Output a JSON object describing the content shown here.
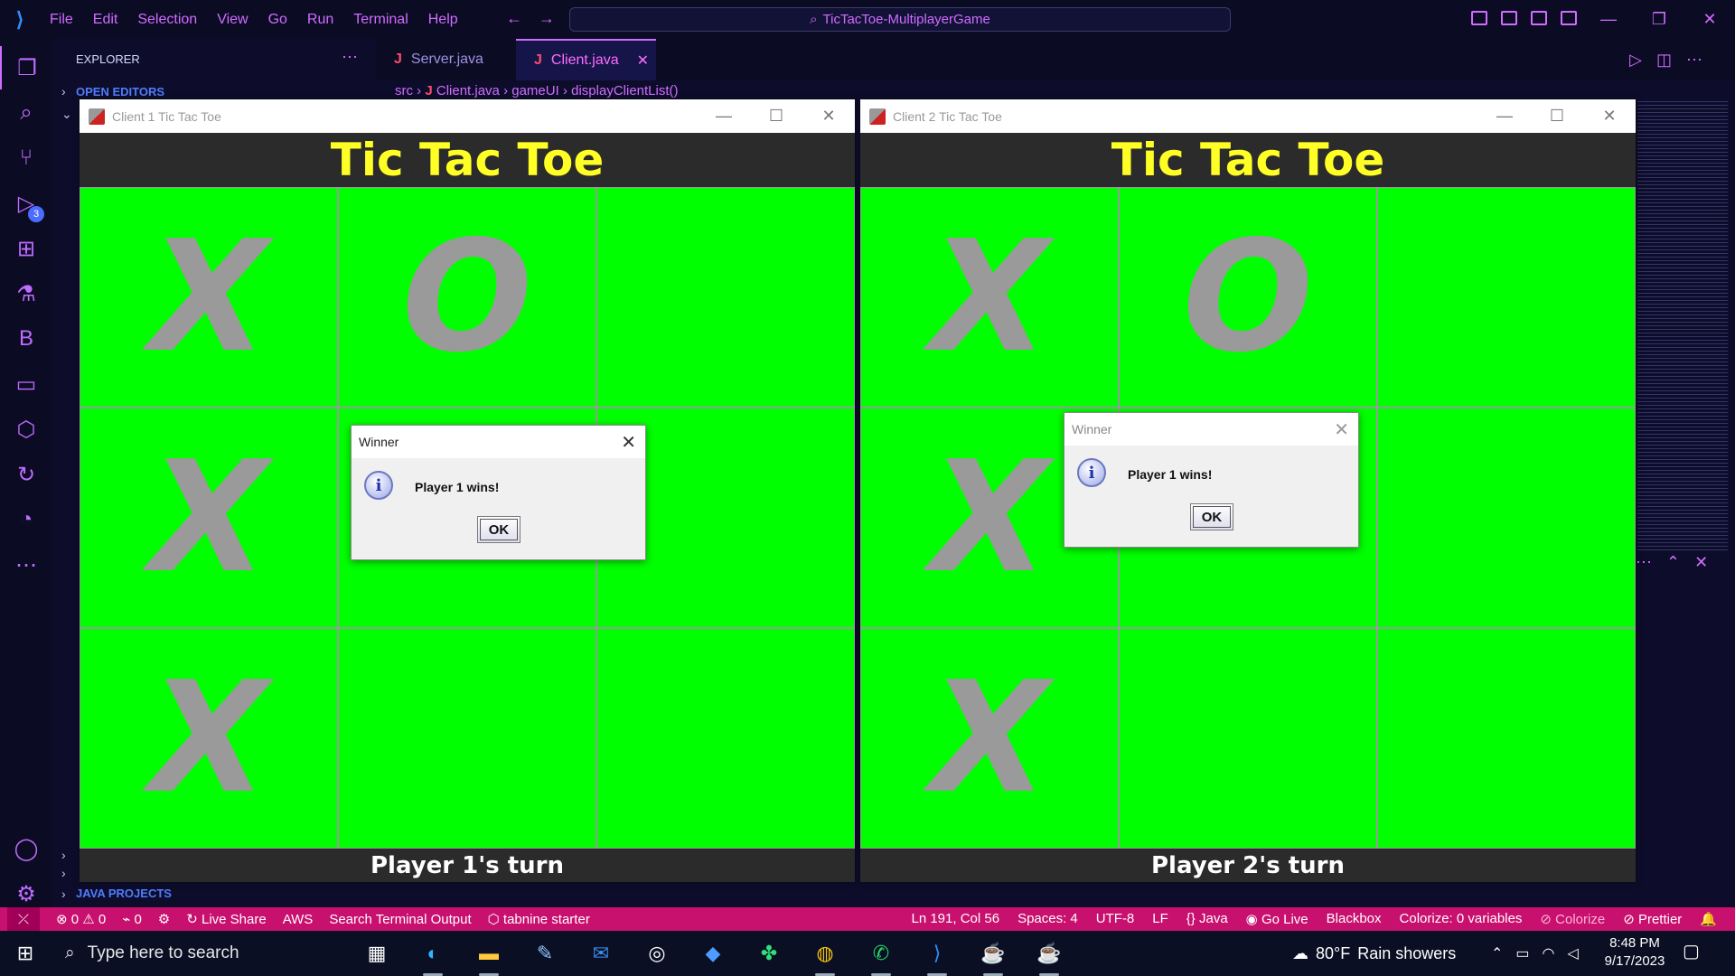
{
  "vscode": {
    "menu": [
      "File",
      "Edit",
      "Selection",
      "View",
      "Go",
      "Run",
      "Terminal",
      "Help"
    ],
    "command_center": "TicTacToe-MultiplayerGame",
    "explorer_title": "EXPLORER",
    "open_editors": "OPEN EDITORS",
    "java_projects": "JAVA PROJECTS",
    "run_badge": "3",
    "tabs": [
      {
        "label": "Server.java",
        "active": false
      },
      {
        "label": "Client.java",
        "active": true
      }
    ],
    "breadcrumb": {
      "folder": "src",
      "file": "Client.java",
      "class": "gameUI",
      "method": "displayClientList()"
    }
  },
  "status_bar": {
    "errors": "0",
    "warnings": "0",
    "ports": "0",
    "live_share": "Live Share",
    "aws": "AWS",
    "search_terminal": "Search Terminal Output",
    "tabnine": "tabnine starter",
    "position": "Ln 191, Col 56",
    "spaces": "Spaces: 4",
    "encoding": "UTF-8",
    "eol": "LF",
    "language": "Java",
    "go_live": "Go Live",
    "blackbox": "Blackbox",
    "colorize_vars": "Colorize: 0 variables",
    "colorize": "Colorize",
    "prettier": "Prettier"
  },
  "clients": [
    {
      "window_title": "Client 1 Tic Tac Toe",
      "game_title": "Tic Tac Toe",
      "board": [
        "X",
        "O",
        "",
        "X",
        "",
        "",
        "X",
        "",
        ""
      ],
      "turn_text": "Player 1's turn",
      "dialog": {
        "title": "Winner",
        "message": "Player 1 wins!",
        "ok": "OK",
        "focused": true
      }
    },
    {
      "window_title": "Client 2 Tic Tac Toe",
      "game_title": "Tic Tac Toe",
      "board": [
        "X",
        "O",
        "",
        "X",
        "",
        "",
        "X",
        "",
        ""
      ],
      "turn_text": "Player 2's turn",
      "dialog": {
        "title": "Winner",
        "message": "Player 1 wins!",
        "ok": "OK",
        "focused": false
      }
    }
  ],
  "taskbar": {
    "search_placeholder": "Type here to search",
    "weather_temp": "80°F",
    "weather_text": "Rain showers",
    "time": "8:48 PM",
    "date": "9/17/2023"
  },
  "colors": {
    "board_green": "#00ff00",
    "title_yellow": "#ffff26",
    "status_bar_pink": "#c8106e",
    "accent_purple": "#d06cff"
  }
}
